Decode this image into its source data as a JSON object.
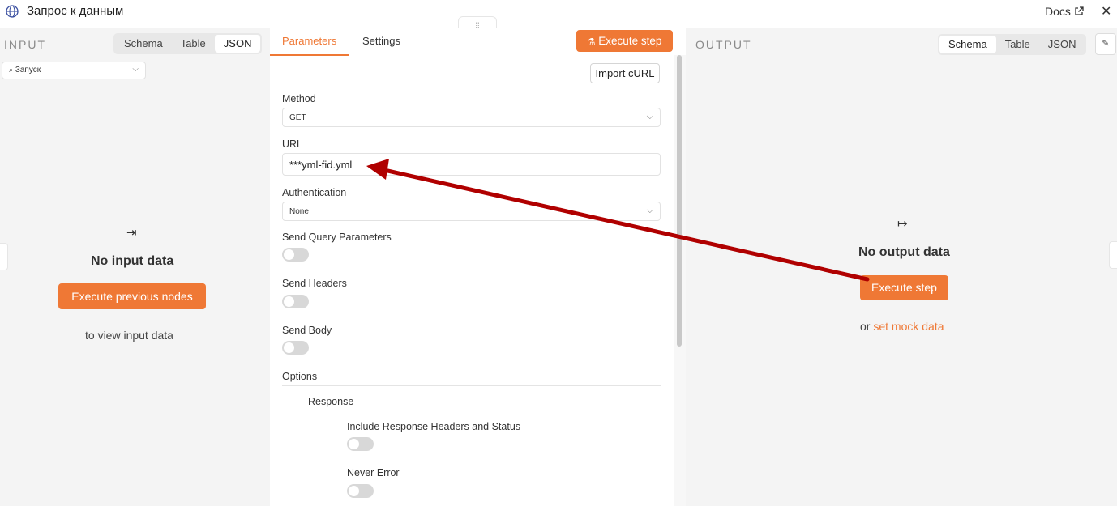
{
  "window": {
    "title": "Запрос к данным",
    "docs_label": "Docs",
    "close_glyph": "✕",
    "drag_glyph": "⁞⁞"
  },
  "input_panel": {
    "label": "INPUT",
    "view_tabs": [
      "Schema",
      "Table",
      "JSON"
    ],
    "active_view": "JSON",
    "source_select": "Запуск",
    "empty_title": "No input data",
    "execute_button": "Execute previous nodes",
    "hint": "to view input data"
  },
  "main_panel": {
    "tabs": [
      "Parameters",
      "Settings"
    ],
    "active_tab": "Parameters",
    "execute_button": "Execute step",
    "import_button": "Import cURL",
    "method": {
      "label": "Method",
      "value": "GET"
    },
    "url": {
      "label": "URL",
      "value": "***yml-fid.yml"
    },
    "authentication": {
      "label": "Authentication",
      "value": "None"
    },
    "send_query": {
      "label": "Send Query Parameters",
      "enabled": false
    },
    "send_headers": {
      "label": "Send Headers",
      "enabled": false
    },
    "send_body": {
      "label": "Send Body",
      "enabled": false
    },
    "options": {
      "label": "Options",
      "response": {
        "label": "Response",
        "include_headers": {
          "label": "Include Response Headers and Status",
          "enabled": false
        },
        "never_error": {
          "label": "Never Error",
          "enabled": false
        }
      }
    }
  },
  "output_panel": {
    "label": "OUTPUT",
    "view_tabs": [
      "Schema",
      "Table",
      "JSON"
    ],
    "active_view": "Schema",
    "empty_title": "No output data",
    "execute_button": "Execute step",
    "or_text": "or",
    "mock_link": "set mock data"
  },
  "colors": {
    "accent": "#ef7835",
    "annotation_arrow": "#b00000"
  }
}
